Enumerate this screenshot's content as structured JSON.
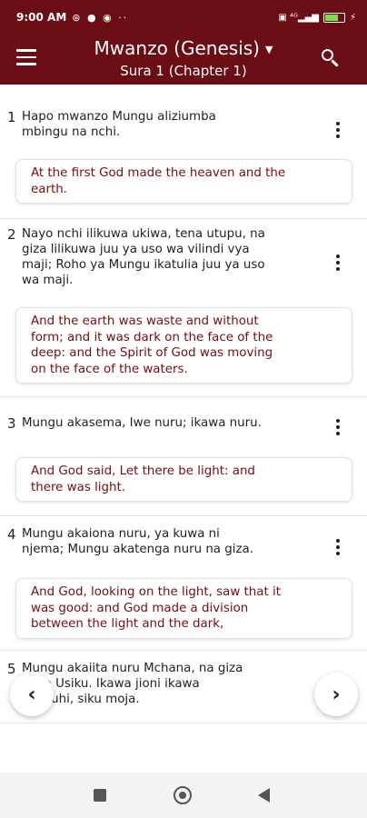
{
  "status": {
    "time": "9:00 AM",
    "left_icons": "⊛ ● ◉ ··",
    "right_icons": "▣ ⁴ᴳ▂▄▆"
  },
  "appbar": {
    "book_title": "Mwanzo (Genesis)",
    "chapter_subtitle": "Sura 1 (Chapter 1)",
    "menu_icon": "hamburger-menu-icon",
    "search_icon": "search-icon",
    "caret_icon": "▼"
  },
  "verses": [
    {
      "num": "1",
      "text": "Hapo mwanzo Mungu aliziumba\nmbingu na nchi.",
      "translation": "At the first God made the heaven and the\nearth."
    },
    {
      "num": "2",
      "text": "Nayo nchi ilikuwa ukiwa, tena utupu, na\ngiza lilikuwa juu ya uso wa vilindi vya\nmaji; Roho ya Mungu ikatulia juu ya uso\nwa maji.",
      "translation": "And the earth was waste and without\nform; and it was dark on the face of the\ndeep: and the Spirit of God was moving\non the face of the waters."
    },
    {
      "num": "3",
      "text": "Mungu akasema, Iwe nuru; ikawa nuru.",
      "translation": "And God said, Let there be light: and\nthere was light."
    },
    {
      "num": "4",
      "text": "Mungu akaiona nuru, ya kuwa ni\nnjema; Mungu akatenga nuru na giza.",
      "translation": "And God, looking on the light, saw that it\nwas good: and God made a division\nbetween the light and the dark,"
    },
    {
      "num": "5",
      "text": "Mungu akaiita nuru Mchana, na giza\naliita Usiku. Ikawa jioni ikawa\nasubuhi, siku moja."
    }
  ],
  "nav": {
    "prev_glyph": "‹",
    "next_glyph": "›"
  },
  "colors": {
    "brand": "#6b0d14",
    "translation_text": "#7a0b12"
  }
}
